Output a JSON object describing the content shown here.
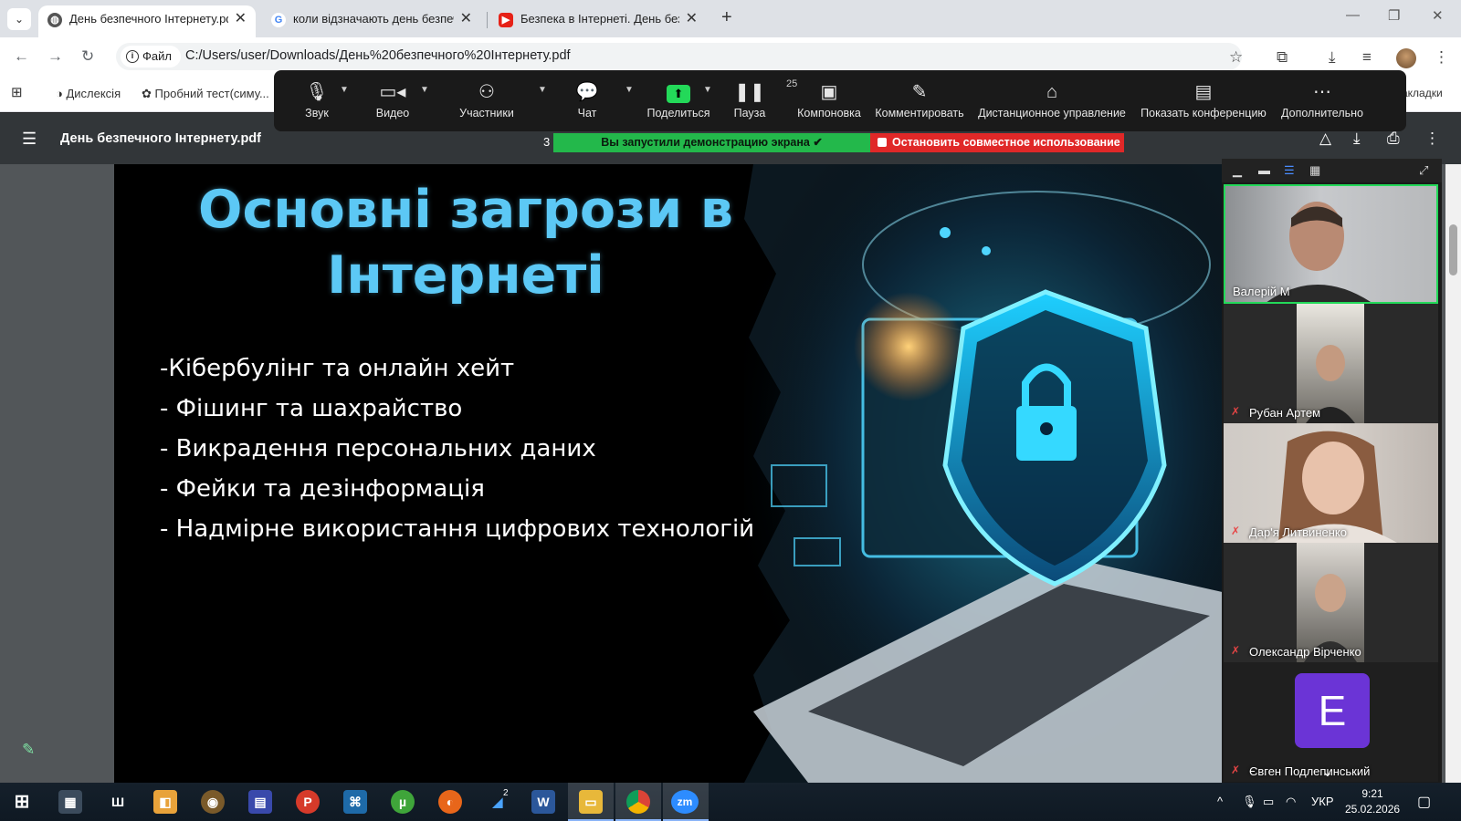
{
  "browser": {
    "tabs": [
      {
        "label": "День безпечного Інтернету.pdf",
        "favicon": "globe-icon",
        "active": true
      },
      {
        "label": "коли відзначають день безпеч",
        "favicon": "google-icon",
        "active": false
      },
      {
        "label": "Безпека в Інтернеті. День безп",
        "favicon": "youtube-icon",
        "active": false
      }
    ],
    "site_chip": "Файл",
    "url": "C:/Users/user/Downloads/День%20безпечного%20Інтернету.pdf",
    "bookmarks": [
      "Дислексія",
      "Пробний тест(симу..."
    ],
    "bookmarks_right": "акладки"
  },
  "pdf": {
    "title": "День безпечного Інтернету.pdf",
    "page_indicator": "3"
  },
  "slide": {
    "title_line1": "Основні загрози в",
    "title_line2": "Інтернеті",
    "bullets": [
      "-Кібербулінг та онлайн хейт",
      "- Фішинг та шахрайство",
      "- Викрадення персональних даних",
      "- Фейки та дезінформація",
      "- Надмірне використання цифрових технологій"
    ]
  },
  "zoom": {
    "toolbar": {
      "audio": "Звук",
      "video": "Видео",
      "participants": "Участники",
      "participants_count": "25",
      "chat": "Чат",
      "share": "Поделиться",
      "pause": "Пауза",
      "layout": "Компоновка",
      "annotate": "Комментировать",
      "remote_control": "Дистанционное управление",
      "show_meeting": "Показать конференцию",
      "more": "Дополнительно"
    },
    "share_status": "Вы запустили демонстрацию экрана",
    "stop_share": "Остановить совместное использование",
    "participants": [
      {
        "name": "Валерій М",
        "muted": false,
        "active_speaker": true
      },
      {
        "name": "Рубан Артем",
        "muted": true
      },
      {
        "name": "Дар'я Литвиненко",
        "muted": true
      },
      {
        "name": "Олександр Вірченко",
        "muted": true
      },
      {
        "name": "Євген Подлепинський",
        "muted": true,
        "avatar_letter": "E",
        "avatar_color": "#6b34d6"
      }
    ]
  },
  "taskbar": {
    "language": "УКР",
    "time": "9:21",
    "date": "25.02.2026",
    "badge": "2"
  },
  "colors": {
    "slide_title": "#5cc8f5",
    "share_green": "#23b84b",
    "stop_red": "#e02828",
    "active_speaker_border": "#23d959"
  }
}
